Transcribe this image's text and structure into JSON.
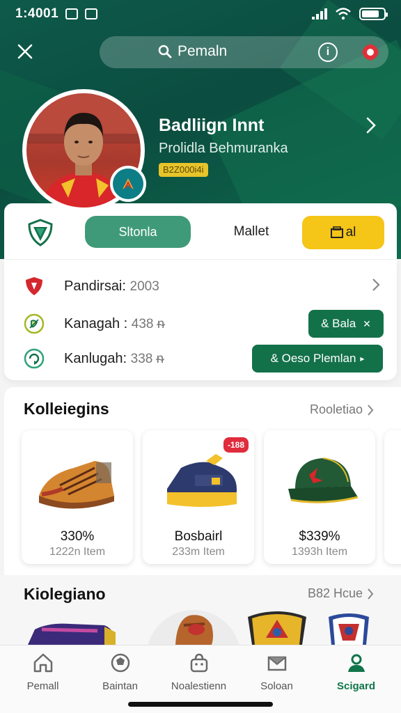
{
  "status_bar": {
    "time": "1:4001",
    "battery_pct": 0.8
  },
  "search": {
    "placeholder": "Pemaln"
  },
  "profile": {
    "name": "Badliign Innt",
    "subtitle": "Prolidla Behmuranka",
    "chip": "B2Z000i4i"
  },
  "tabs": {
    "squad": "Sltonla",
    "market": "Mallet",
    "gold": "al"
  },
  "stats": [
    {
      "label": "Pandirsai:",
      "value": "2003"
    },
    {
      "label": "Kanagah :",
      "value": "438 ᵰ"
    },
    {
      "label": "Kanlugah:",
      "value": "338 ᵰ"
    }
  ],
  "actions": {
    "bala": "& Bala",
    "deso": "& Oeso Plemlan"
  },
  "collections": {
    "title": "Kolleiegins",
    "link": "Rooletiao",
    "items": [
      {
        "price": "330%",
        "count": "1222n Item",
        "icon": "boot-icon"
      },
      {
        "price": "Bosbairl",
        "count": "233m Item",
        "icon": "sneaker-icon",
        "badge": "-188"
      },
      {
        "price": "$339%",
        "count": "1393h Item",
        "icon": "cap-icon"
      }
    ]
  },
  "section2": {
    "title": "Kiolegiano",
    "link": "B82 Hcue"
  },
  "nav": [
    {
      "label": "Pemall",
      "icon": "home-icon"
    },
    {
      "label": "Baintan",
      "icon": "ball-icon"
    },
    {
      "label": "Noalestienn",
      "icon": "bag-icon"
    },
    {
      "label": "Soloan",
      "icon": "mail-icon"
    },
    {
      "label": "Scigard",
      "icon": "profile-icon",
      "active": true
    }
  ],
  "colors": {
    "primary_green": "#13714a",
    "accent_gold": "#f5c518",
    "hero_green": "#0e5a4a"
  }
}
